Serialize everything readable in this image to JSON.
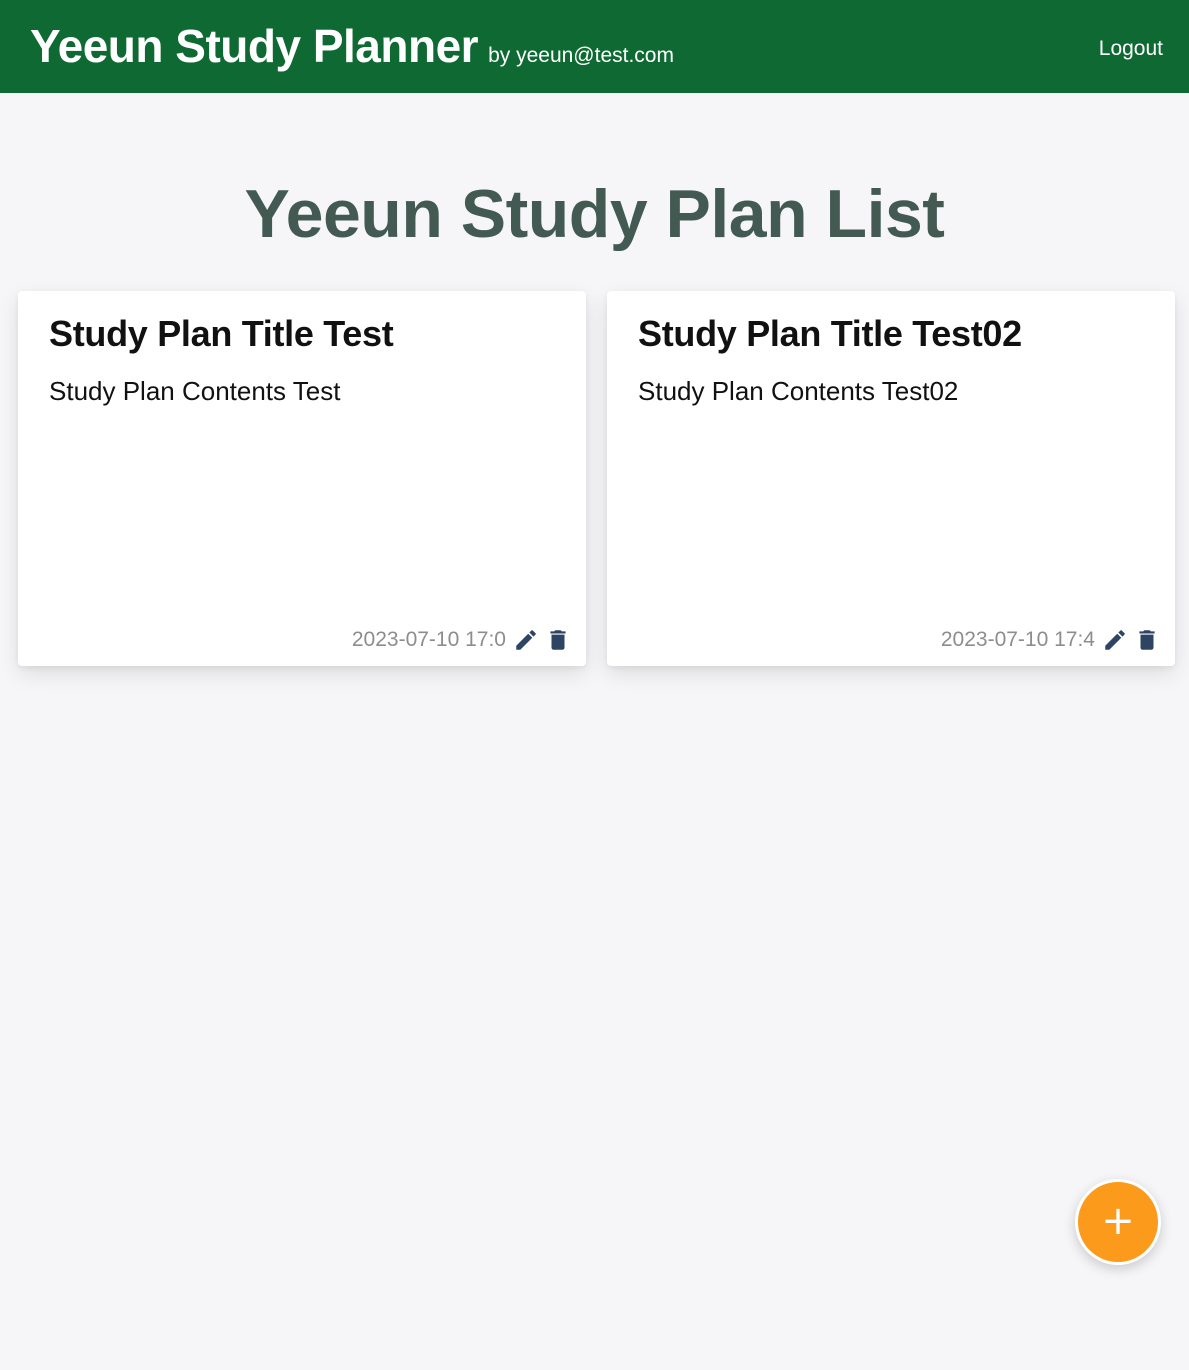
{
  "header": {
    "app_title": "Yeeun Study Planner",
    "byline": "by yeeun@test.com",
    "logout_label": "Logout",
    "background_color": "#0e6a32"
  },
  "main": {
    "heading": "Yeeun Study Plan List",
    "plans": [
      {
        "title": "Study Plan Title Test",
        "contents": "Study Plan Contents Test",
        "date": "2023-07-10 17:0",
        "edit_icon": "pencil-icon",
        "delete_icon": "trash-icon"
      },
      {
        "title": "Study Plan Title Test02",
        "contents": "Study Plan Contents Test02",
        "date": "2023-07-10 17:4",
        "edit_icon": "pencil-icon",
        "delete_icon": "trash-icon"
      }
    ]
  },
  "fab": {
    "label": "+",
    "icon": "plus-icon",
    "color": "#fb9a1b"
  }
}
